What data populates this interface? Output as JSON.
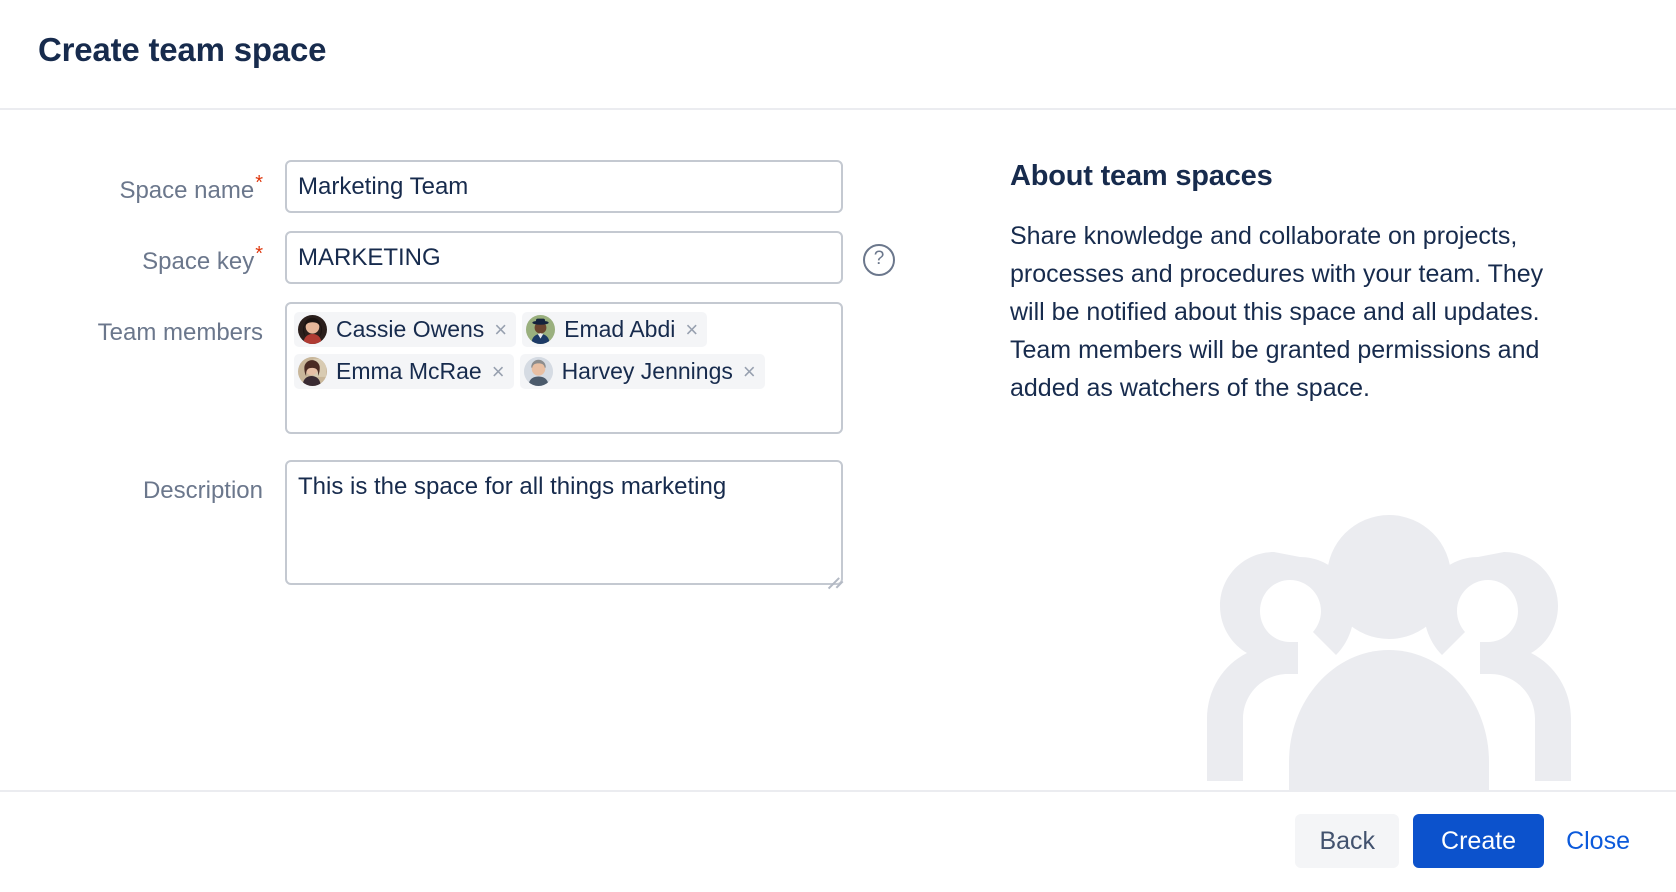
{
  "dialog": {
    "title": "Create team space"
  },
  "form": {
    "space_name": {
      "label": "Space name",
      "required_marker": "*",
      "value": "Marketing Team",
      "placeholder": ""
    },
    "space_key": {
      "label": "Space key",
      "required_marker": "*",
      "value": "MARKETING",
      "placeholder": "",
      "help_icon": "question-circle-icon"
    },
    "team_members": {
      "label": "Team members",
      "chips": [
        {
          "name": "Cassie Owens",
          "remove_label": "×",
          "avatar": "photo-avatar"
        },
        {
          "name": "Emad Abdi",
          "remove_label": "×",
          "avatar": "photo-avatar"
        },
        {
          "name": "Emma McRae",
          "remove_label": "×",
          "avatar": "photo-avatar"
        },
        {
          "name": "Harvey Jennings",
          "remove_label": "×",
          "avatar": "photo-avatar"
        }
      ]
    },
    "description": {
      "label": "Description",
      "value": "This is the space for all things marketing",
      "placeholder": ""
    }
  },
  "info_panel": {
    "title": "About team spaces",
    "body": "Share knowledge and collaborate on projects, processes and procedures with your team. They will be notified about this space and all updates. Team members will be granted permissions and added as watchers of the space.",
    "illustration": "three-people-icon"
  },
  "footer": {
    "back_label": "Back",
    "create_label": "Create",
    "close_label": "Close"
  },
  "colors": {
    "primary": "#0C52CC",
    "link": "#0C5ADB",
    "required": "#DE350B",
    "label_text": "#6B778C",
    "body_text": "#172B4D",
    "border": "#C4C9D1",
    "divider": "#EBECF0",
    "chip_bg": "#F4F5F7",
    "illustration": "#EBECF0"
  }
}
